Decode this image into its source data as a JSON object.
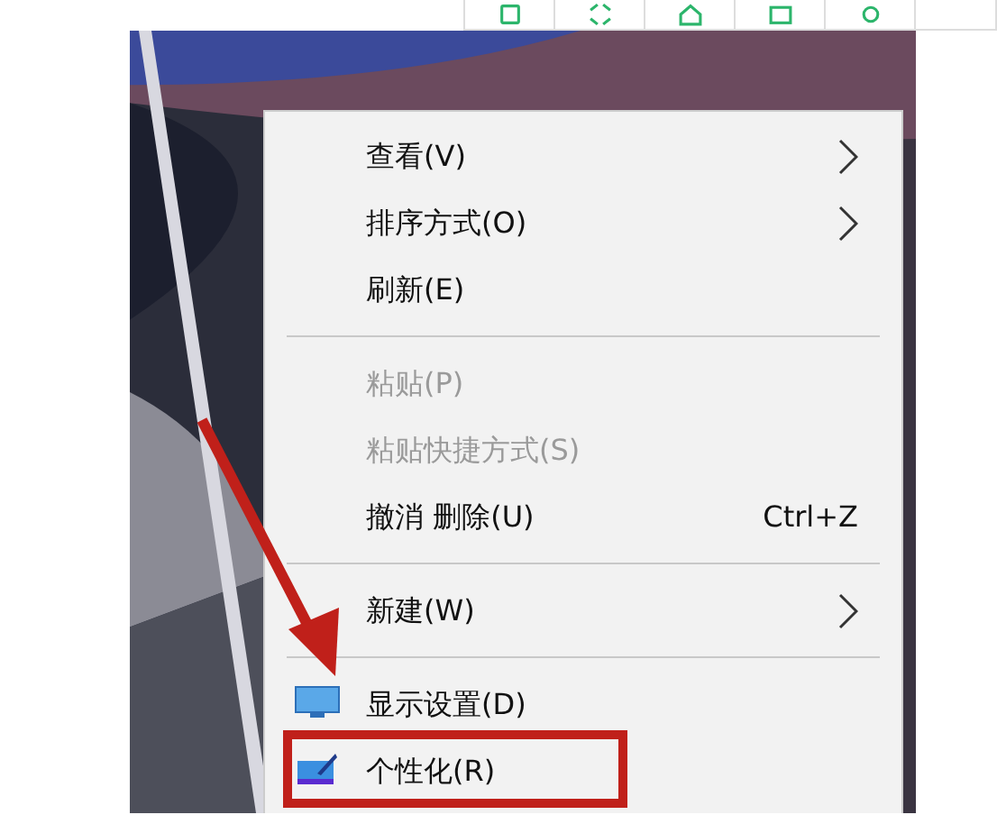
{
  "context_menu": {
    "items": [
      {
        "kind": "item",
        "label": "查看(V)",
        "submenu": true,
        "disabled": false
      },
      {
        "kind": "item",
        "label": "排序方式(O)",
        "submenu": true,
        "disabled": false
      },
      {
        "kind": "item",
        "label": "刷新(E)",
        "submenu": false,
        "disabled": false
      },
      {
        "kind": "separator"
      },
      {
        "kind": "item",
        "label": "粘贴(P)",
        "submenu": false,
        "disabled": true
      },
      {
        "kind": "item",
        "label": "粘贴快捷方式(S)",
        "submenu": false,
        "disabled": true
      },
      {
        "kind": "item",
        "label": "撤消 删除(U)",
        "shortcut": "Ctrl+Z",
        "submenu": false,
        "disabled": false
      },
      {
        "kind": "separator"
      },
      {
        "kind": "item",
        "label": "新建(W)",
        "submenu": true,
        "disabled": false
      },
      {
        "kind": "separator"
      },
      {
        "kind": "display",
        "label": "显示设置(D)",
        "submenu": false,
        "disabled": false
      },
      {
        "kind": "personalize",
        "label": "个性化(R)",
        "submenu": false,
        "disabled": false,
        "highlighted": true
      }
    ]
  }
}
